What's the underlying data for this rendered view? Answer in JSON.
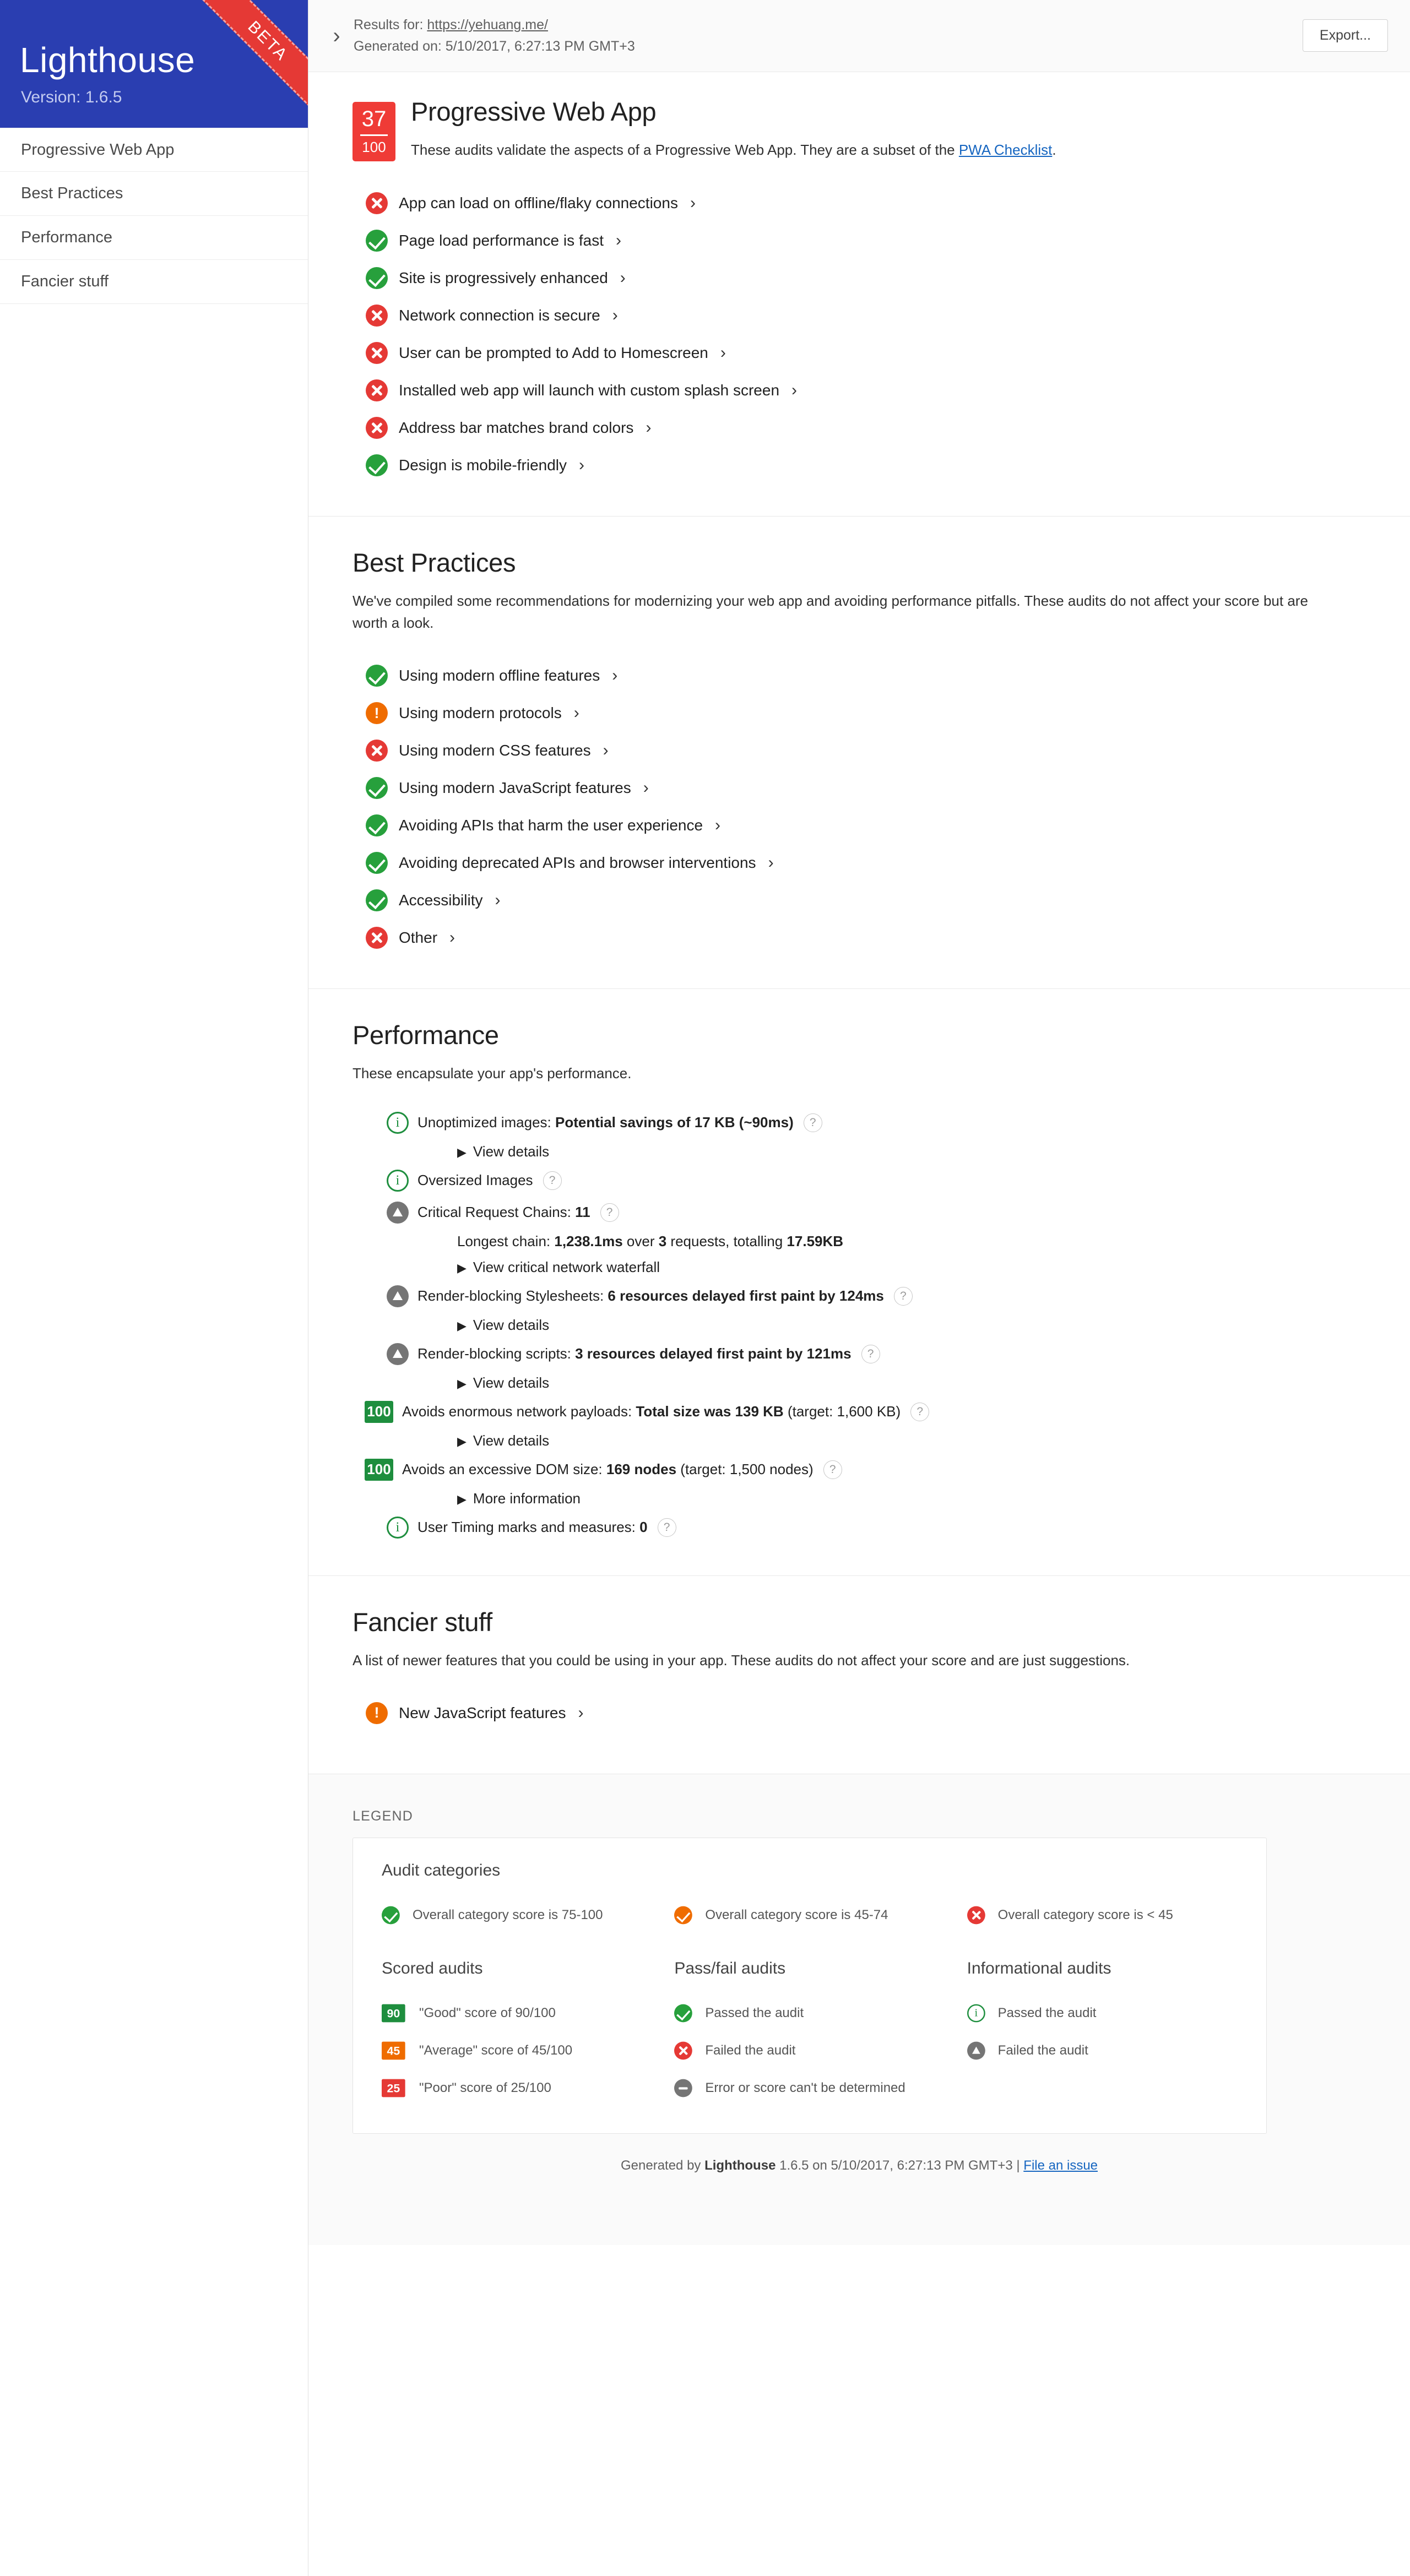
{
  "brand": {
    "title": "Lighthouse",
    "version_label": "Version: 1.6.5",
    "ribbon": "BETA"
  },
  "sidebar": {
    "items": [
      {
        "label": "Progressive Web App"
      },
      {
        "label": "Best Practices"
      },
      {
        "label": "Performance"
      },
      {
        "label": "Fancier stuff"
      }
    ]
  },
  "topbar": {
    "collapse_icon": "chevron-right-icon",
    "results_prefix": "Results for: ",
    "results_url": "https://yehuang.me/",
    "generated_on": "Generated on: 5/10/2017, 6:27:13 PM GMT+3",
    "export_label": "Export..."
  },
  "pwa": {
    "score": "37",
    "score_denominator": "100",
    "title": "Progressive Web App",
    "desc_before": "These audits validate the aspects of a Progressive Web App. They are a subset of the ",
    "desc_link": "PWA Checklist",
    "desc_after": ".",
    "audits": [
      {
        "status": "fail",
        "label": "App can load on offline/flaky connections"
      },
      {
        "status": "pass",
        "label": "Page load performance is fast"
      },
      {
        "status": "pass",
        "label": "Site is progressively enhanced"
      },
      {
        "status": "fail",
        "label": "Network connection is secure"
      },
      {
        "status": "fail",
        "label": "User can be prompted to Add to Homescreen"
      },
      {
        "status": "fail",
        "label": "Installed web app will launch with custom splash screen"
      },
      {
        "status": "fail",
        "label": "Address bar matches brand colors"
      },
      {
        "status": "pass",
        "label": "Design is mobile-friendly"
      }
    ]
  },
  "best_practices": {
    "title": "Best Practices",
    "desc": "We've compiled some recommendations for modernizing your web app and avoiding performance pitfalls. These audits do not affect your score but are worth a look.",
    "audits": [
      {
        "status": "pass",
        "label": "Using modern offline features"
      },
      {
        "status": "warn",
        "label": "Using modern protocols"
      },
      {
        "status": "fail",
        "label": "Using modern CSS features"
      },
      {
        "status": "pass",
        "label": "Using modern JavaScript features"
      },
      {
        "status": "pass",
        "label": "Avoiding APIs that harm the user experience"
      },
      {
        "status": "pass",
        "label": "Avoiding deprecated APIs and browser interventions"
      },
      {
        "status": "pass",
        "label": "Accessibility"
      },
      {
        "status": "fail",
        "label": "Other"
      }
    ]
  },
  "performance": {
    "title": "Performance",
    "desc": "These encapsulate your app's performance.",
    "rows": [
      {
        "icon": "info",
        "text_plain": "Unoptimized images: ",
        "text_bold": "Potential savings of 17 KB (~90ms)",
        "help": "?",
        "children": [
          {
            "type": "disclosure",
            "label": "View details"
          }
        ]
      },
      {
        "icon": "info",
        "text_plain": "Oversized Images",
        "text_bold": "",
        "help": "?",
        "children": []
      },
      {
        "icon": "warn-tri",
        "text_plain": "Critical Request Chains: ",
        "text_bold": "11",
        "help": "?",
        "children": [
          {
            "type": "sub",
            "parts": [
              {
                "t": "Longest chain: ",
                "b": false
              },
              {
                "t": "1,238.1ms",
                "b": true
              },
              {
                "t": " over ",
                "b": false
              },
              {
                "t": "3",
                "b": true
              },
              {
                "t": " requests, totalling ",
                "b": false
              },
              {
                "t": "17.59KB",
                "b": true
              }
            ]
          },
          {
            "type": "disclosure",
            "label": "View critical network waterfall"
          }
        ]
      },
      {
        "icon": "warn-tri",
        "text_plain": "Render-blocking Stylesheets: ",
        "text_bold": "6 resources delayed first paint by 124ms",
        "help": "?",
        "children": [
          {
            "type": "disclosure",
            "label": "View details"
          }
        ]
      },
      {
        "icon": "warn-tri",
        "text_plain": "Render-blocking scripts: ",
        "text_bold": "3 resources delayed first paint by 121ms",
        "help": "?",
        "children": [
          {
            "type": "disclosure",
            "label": "View details"
          }
        ]
      },
      {
        "icon": "score100",
        "score": "100",
        "text_plain": "Avoids enormous network payloads: ",
        "text_bold": "Total size was 139 KB",
        "text_tail": " (target: 1,600 KB)",
        "help": "?",
        "children": [
          {
            "type": "disclosure",
            "label": "View details"
          }
        ]
      },
      {
        "icon": "score100",
        "score": "100",
        "text_plain": "Avoids an excessive DOM size: ",
        "text_bold": "169 nodes",
        "text_tail": " (target: 1,500 nodes)",
        "help": "?",
        "children": [
          {
            "type": "disclosure",
            "label": "More information"
          }
        ]
      },
      {
        "icon": "info",
        "text_plain": "User Timing marks and measures: ",
        "text_bold": "0",
        "help": "?",
        "children": []
      }
    ]
  },
  "fancier": {
    "title": "Fancier stuff",
    "desc": "A list of newer features that you could be using in your app. These audits do not affect your score and are just suggestions.",
    "audits": [
      {
        "status": "warn",
        "label": "New JavaScript features"
      }
    ]
  },
  "legend": {
    "label": "LEGEND",
    "audit_categories_title": "Audit categories",
    "audit_categories": [
      {
        "icon": "pass",
        "text": "Overall category score is 75-100"
      },
      {
        "icon": "warn-check",
        "text": "Overall category score is 45-74"
      },
      {
        "icon": "fail",
        "text": "Overall category score is < 45"
      }
    ],
    "columns": [
      {
        "title": "Scored audits",
        "items": [
          {
            "icon": "score-good",
            "score": "90",
            "text": "\"Good\" score of 90/100"
          },
          {
            "icon": "score-avg",
            "score": "45",
            "text": "\"Average\" score of 45/100"
          },
          {
            "icon": "score-poor",
            "score": "25",
            "text": "\"Poor\" score of 25/100"
          }
        ]
      },
      {
        "title": "Pass/fail audits",
        "items": [
          {
            "icon": "pass",
            "text": "Passed the audit"
          },
          {
            "icon": "fail",
            "text": "Failed the audit"
          },
          {
            "icon": "minus",
            "text": "Error or score can't be determined"
          }
        ]
      },
      {
        "title": "Informational audits",
        "items": [
          {
            "icon": "info",
            "text": "Passed the audit"
          },
          {
            "icon": "warn-tri",
            "text": "Failed the audit"
          }
        ]
      }
    ]
  },
  "footer": {
    "prefix": "Generated by ",
    "brand": "Lighthouse",
    "middle": " 1.6.5 on 5/10/2017, 6:27:13 PM GMT+3 | ",
    "link": "File an issue"
  }
}
